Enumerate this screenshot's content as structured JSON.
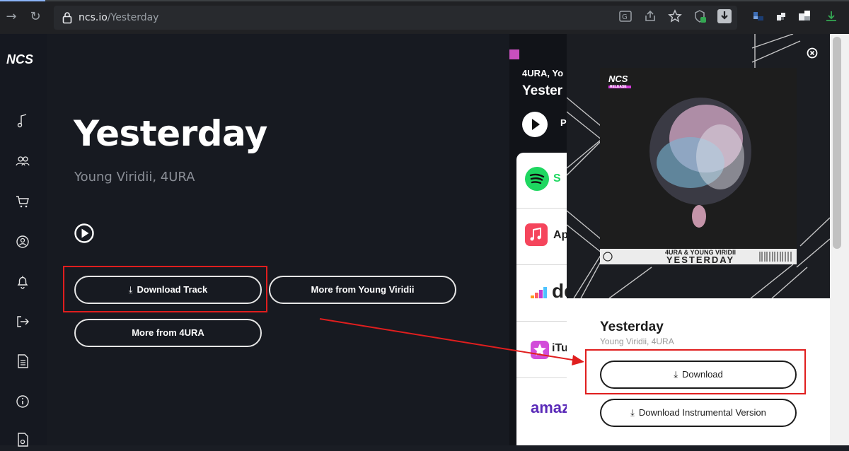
{
  "browser": {
    "url_host": "ncs.io",
    "url_path": "/Yesterday"
  },
  "sidebar": {
    "logo": "NCS",
    "items": [
      "music-note-icon",
      "users-icon",
      "cart-icon",
      "user-circle-icon",
      "bell-icon",
      "logout-icon",
      "document-icon",
      "info-icon",
      "file-music-icon"
    ]
  },
  "track": {
    "title": "Yesterday",
    "artists": "Young Viridii, 4URA",
    "download_label": "Download Track",
    "more_young_label": "More from Young Viridii",
    "more_4ura_label": "More from 4URA"
  },
  "stream_panel": {
    "artists_fragment": "4URA, Yo",
    "title_fragment": "Yester",
    "play_fragment": "P",
    "services": [
      {
        "name": "spotify-icon",
        "text": "S"
      },
      {
        "name": "apple-music-icon",
        "text": "Ap"
      },
      {
        "name": "deezer-icon",
        "text": "de"
      },
      {
        "name": "itunes-icon",
        "text": "iTu"
      },
      {
        "name": "amazon-icon",
        "text": "amaz"
      }
    ]
  },
  "modal": {
    "cover_logo": "NCS",
    "cover_logo_sub": "RELEASE",
    "cover_artists": "4URA & YOUNG VIRIDII",
    "cover_title": "YESTERDAY",
    "title": "Yesterday",
    "artists": "Young Viridii, 4URA",
    "download_label": "Download",
    "instrumental_label": "Download Instrumental Version"
  },
  "colors": {
    "highlight": "#e01e1e",
    "main_bg": "#171a21",
    "sidebar_bg": "#151820"
  }
}
